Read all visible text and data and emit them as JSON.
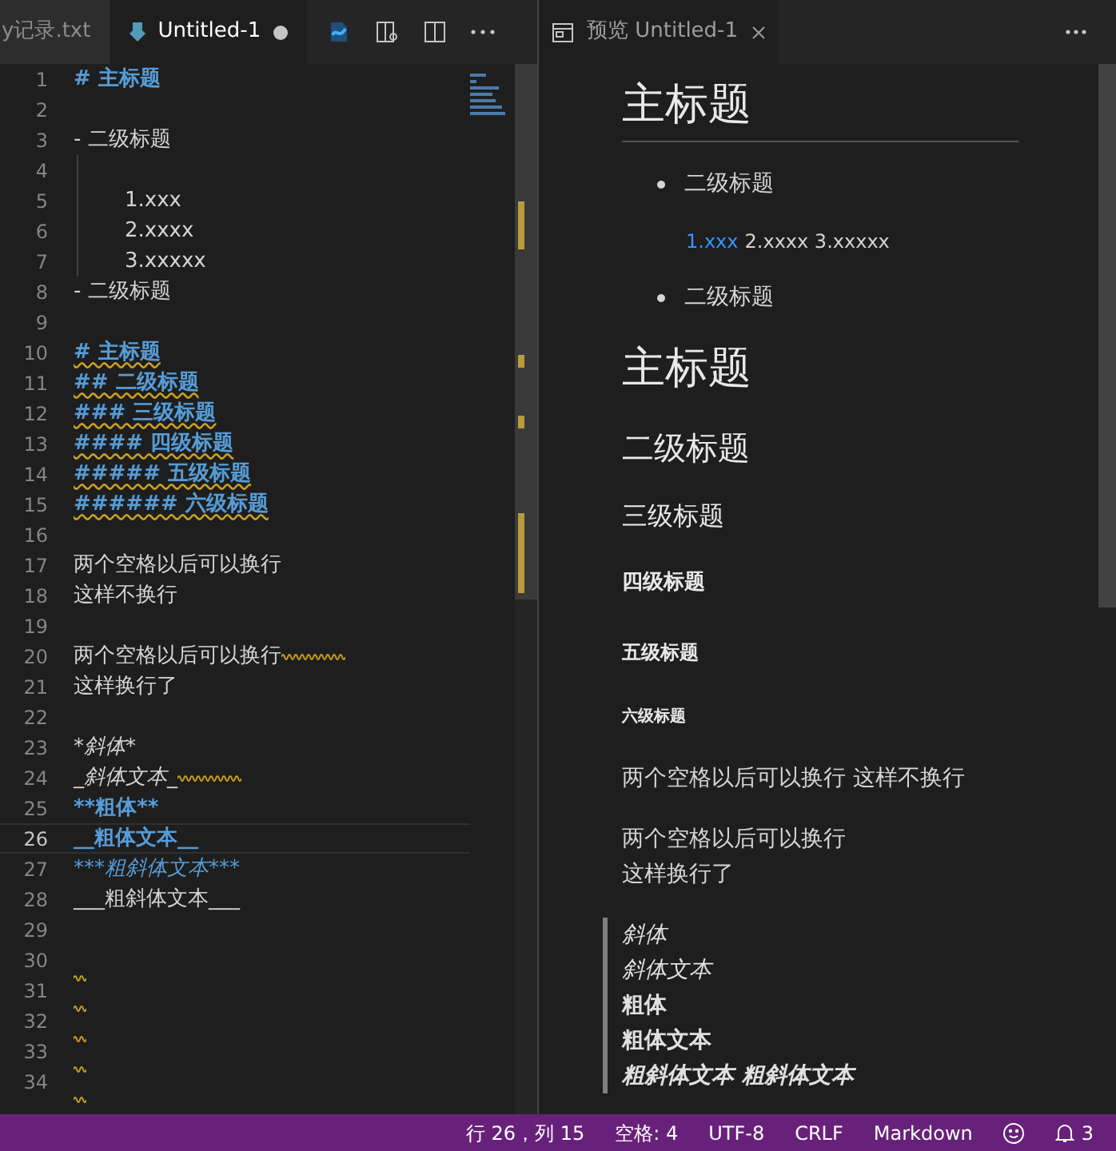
{
  "left_tabs": [
    {
      "label": "y记录.txt",
      "selected": false,
      "dirty": false
    },
    {
      "label": "Untitled-1",
      "selected": true,
      "dirty": true
    }
  ],
  "editor": {
    "lines": [
      {
        "number": "1",
        "text": "# 主标题",
        "kind": "heading",
        "underlined": false,
        "trailing_warning": false,
        "current": false
      },
      {
        "number": "2",
        "kind": "blank",
        "trailing_warning": false,
        "current": false
      },
      {
        "number": "3",
        "text": "- 二级标题",
        "kind": "list",
        "underlined": false,
        "trailing_warning": false,
        "current": false
      },
      {
        "number": "4",
        "kind": "nested",
        "trailing_warning": false,
        "current": false
      },
      {
        "number": "5",
        "text": "1.xxx",
        "kind": "nested",
        "underlined": false,
        "trailing_warning": false,
        "current": false
      },
      {
        "number": "6",
        "text": "2.xxxx",
        "kind": "nested",
        "underlined": false,
        "trailing_warning": false,
        "current": false
      },
      {
        "number": "7",
        "text": "3.xxxxx",
        "kind": "nested",
        "underlined": false,
        "trailing_warning": false,
        "current": false
      },
      {
        "number": "8",
        "text": "- 二级标题",
        "kind": "list",
        "underlined": false,
        "trailing_warning": false,
        "current": false
      },
      {
        "number": "9",
        "kind": "blank",
        "trailing_warning": false,
        "current": false
      },
      {
        "number": "10",
        "text": "# 主标题",
        "kind": "heading",
        "underlined": true,
        "trailing_warning": false,
        "current": false
      },
      {
        "number": "11",
        "text": "## 二级标题",
        "kind": "heading",
        "underlined": true,
        "trailing_warning": false,
        "current": false
      },
      {
        "number": "12",
        "text": "### 三级标题",
        "kind": "heading",
        "underlined": true,
        "trailing_warning": false,
        "current": false
      },
      {
        "number": "13",
        "text": "#### 四级标题",
        "kind": "heading",
        "underlined": true,
        "trailing_warning": false,
        "current": false
      },
      {
        "number": "14",
        "text": "##### 五级标题",
        "kind": "heading",
        "underlined": true,
        "trailing_warning": false,
        "current": false
      },
      {
        "number": "15",
        "text": "###### 六级标题",
        "kind": "heading",
        "underlined": true,
        "trailing_warning": false,
        "current": false
      },
      {
        "number": "16",
        "kind": "blank",
        "trailing_warning": false,
        "current": false
      },
      {
        "number": "17",
        "text": "两个空格以后可以换行",
        "kind": "plain",
        "underlined": false,
        "trailing_warning": false,
        "current": false
      },
      {
        "number": "18",
        "text": "这样不换行",
        "kind": "plain",
        "underlined": false,
        "trailing_warning": false,
        "current": false
      },
      {
        "number": "19",
        "kind": "blank",
        "trailing_warning": false,
        "current": false
      },
      {
        "number": "20",
        "text": "两个空格以后可以换行",
        "kind": "plain",
        "underlined": false,
        "trailing_warning": true,
        "current": false
      },
      {
        "number": "21",
        "text": "这样换行了",
        "kind": "plain",
        "underlined": false,
        "trailing_warning": false,
        "current": false
      },
      {
        "number": "22",
        "kind": "blank",
        "trailing_warning": false,
        "current": false
      },
      {
        "number": "23",
        "text": "*斜体*",
        "kind": "italic",
        "underlined": false,
        "trailing_warning": false,
        "current": false
      },
      {
        "number": "24",
        "text": "_斜体文本_",
        "kind": "italic",
        "underlined": false,
        "trailing_warning": true,
        "current": false
      },
      {
        "number": "25",
        "text": "**粗体**",
        "kind": "bold",
        "underlined": false,
        "trailing_warning": false,
        "current": false
      },
      {
        "number": "26",
        "text": "__粗体文本__",
        "kind": "bold",
        "underlined": false,
        "trailing_warning": false,
        "current": true
      },
      {
        "number": "27",
        "text": "***粗斜体文本***",
        "kind": "bolditalic",
        "underlined": false,
        "trailing_warning": false,
        "current": false
      },
      {
        "number": "28",
        "text": "___粗斜体文本___",
        "kind": "plain",
        "underlined": false,
        "trailing_warning": false,
        "current": false
      },
      {
        "number": "29",
        "kind": "blank",
        "trailing_warning": false,
        "current": false
      },
      {
        "number": "30",
        "kind": "blank",
        "trailing_warning": true,
        "current": false
      },
      {
        "number": "31",
        "kind": "blank",
        "trailing_warning": true,
        "current": false
      },
      {
        "number": "32",
        "kind": "blank",
        "trailing_warning": true,
        "current": false
      },
      {
        "number": "33",
        "kind": "blank",
        "trailing_warning": true,
        "current": false
      },
      {
        "number": "34",
        "kind": "blank",
        "trailing_warning": true,
        "current": false
      }
    ]
  },
  "preview_tab": {
    "label": "预览 Untitled-1"
  },
  "preview": {
    "blocks": [
      {
        "kind": "h1",
        "text": "主标题",
        "rule": true
      },
      {
        "kind": "bullet",
        "text": "二级标题"
      },
      {
        "kind": "numbered",
        "link": "1.xxx",
        "text": "2.xxxx 3.xxxxx"
      },
      {
        "kind": "bullet",
        "text": "二级标题"
      },
      {
        "kind": "h1",
        "text": "主标题",
        "rule": false
      },
      {
        "kind": "h2",
        "text": "二级标题"
      },
      {
        "kind": "h3",
        "text": "三级标题"
      },
      {
        "kind": "h4",
        "text": "四级标题"
      },
      {
        "kind": "h5",
        "text": "五级标题"
      },
      {
        "kind": "h6",
        "text": "六级标题"
      },
      {
        "kind": "para",
        "lines": [
          "两个空格以后可以换行 这样不换行"
        ]
      },
      {
        "kind": "para",
        "lines": [
          "两个空格以后可以换行",
          "这样换行了"
        ]
      },
      {
        "kind": "quote",
        "items": [
          {
            "text": "斜体",
            "kind": "italic"
          },
          {
            "text": "斜体文本",
            "kind": "italic"
          },
          {
            "text": "粗体",
            "kind": "bold"
          },
          {
            "text": "粗体文本",
            "kind": "bold"
          },
          {
            "text": "粗斜体文本 粗斜体文本",
            "kind": "bolditalic"
          }
        ]
      }
    ]
  },
  "status_bar": {
    "items": [
      "行 26，列 15",
      "空格: 4",
      "UTF-8",
      "CRLF",
      "Markdown"
    ],
    "notifications": "3"
  }
}
